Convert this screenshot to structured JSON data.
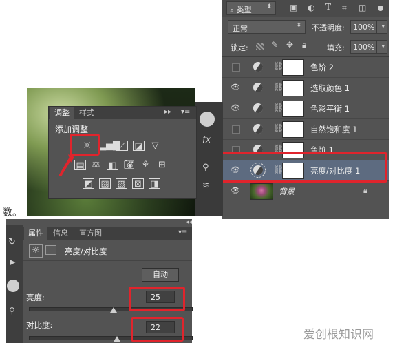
{
  "layers_panel": {
    "filter_label": "类型",
    "filter_icons": [
      "image-filter-icon",
      "adjustment-filter-icon",
      "text-filter-icon",
      "shape-filter-icon",
      "smart-object-filter-icon"
    ],
    "blend_mode": "正常",
    "opacity_label": "不透明度:",
    "opacity_value": "100%",
    "lock_label": "锁定:",
    "fill_label": "填充:",
    "fill_value": "100%",
    "layers": [
      {
        "name": "色阶 2",
        "visible": false,
        "selected": false
      },
      {
        "name": "选取颜色 1",
        "visible": true,
        "selected": false
      },
      {
        "name": "色彩平衡 1",
        "visible": true,
        "selected": false
      },
      {
        "name": "自然饱和度 1",
        "visible": false,
        "selected": false
      },
      {
        "name": "色阶 1",
        "visible": false,
        "selected": false
      },
      {
        "name": "亮度/对比度 1",
        "visible": true,
        "selected": true
      },
      {
        "name": "背景",
        "visible": true,
        "selected": false,
        "locked": true
      }
    ]
  },
  "adjustments_panel": {
    "tab_adjust": "调整",
    "tab_style": "样式",
    "heading": "添加调整"
  },
  "prefix_text": "数。",
  "properties_panel": {
    "tab_properties": "属性",
    "tab_info": "信息",
    "tab_histogram": "直方图",
    "adjustment_name": "亮度/对比度",
    "auto_button": "自动",
    "brightness_label": "亮度:",
    "brightness_value": "25",
    "contrast_label": "对比度:",
    "contrast_value": "22"
  },
  "watermark": "爱创根知识网",
  "colors": {
    "highlight": "#e0242c",
    "panel": "#535353",
    "panel_dark": "#3f3f3f"
  }
}
